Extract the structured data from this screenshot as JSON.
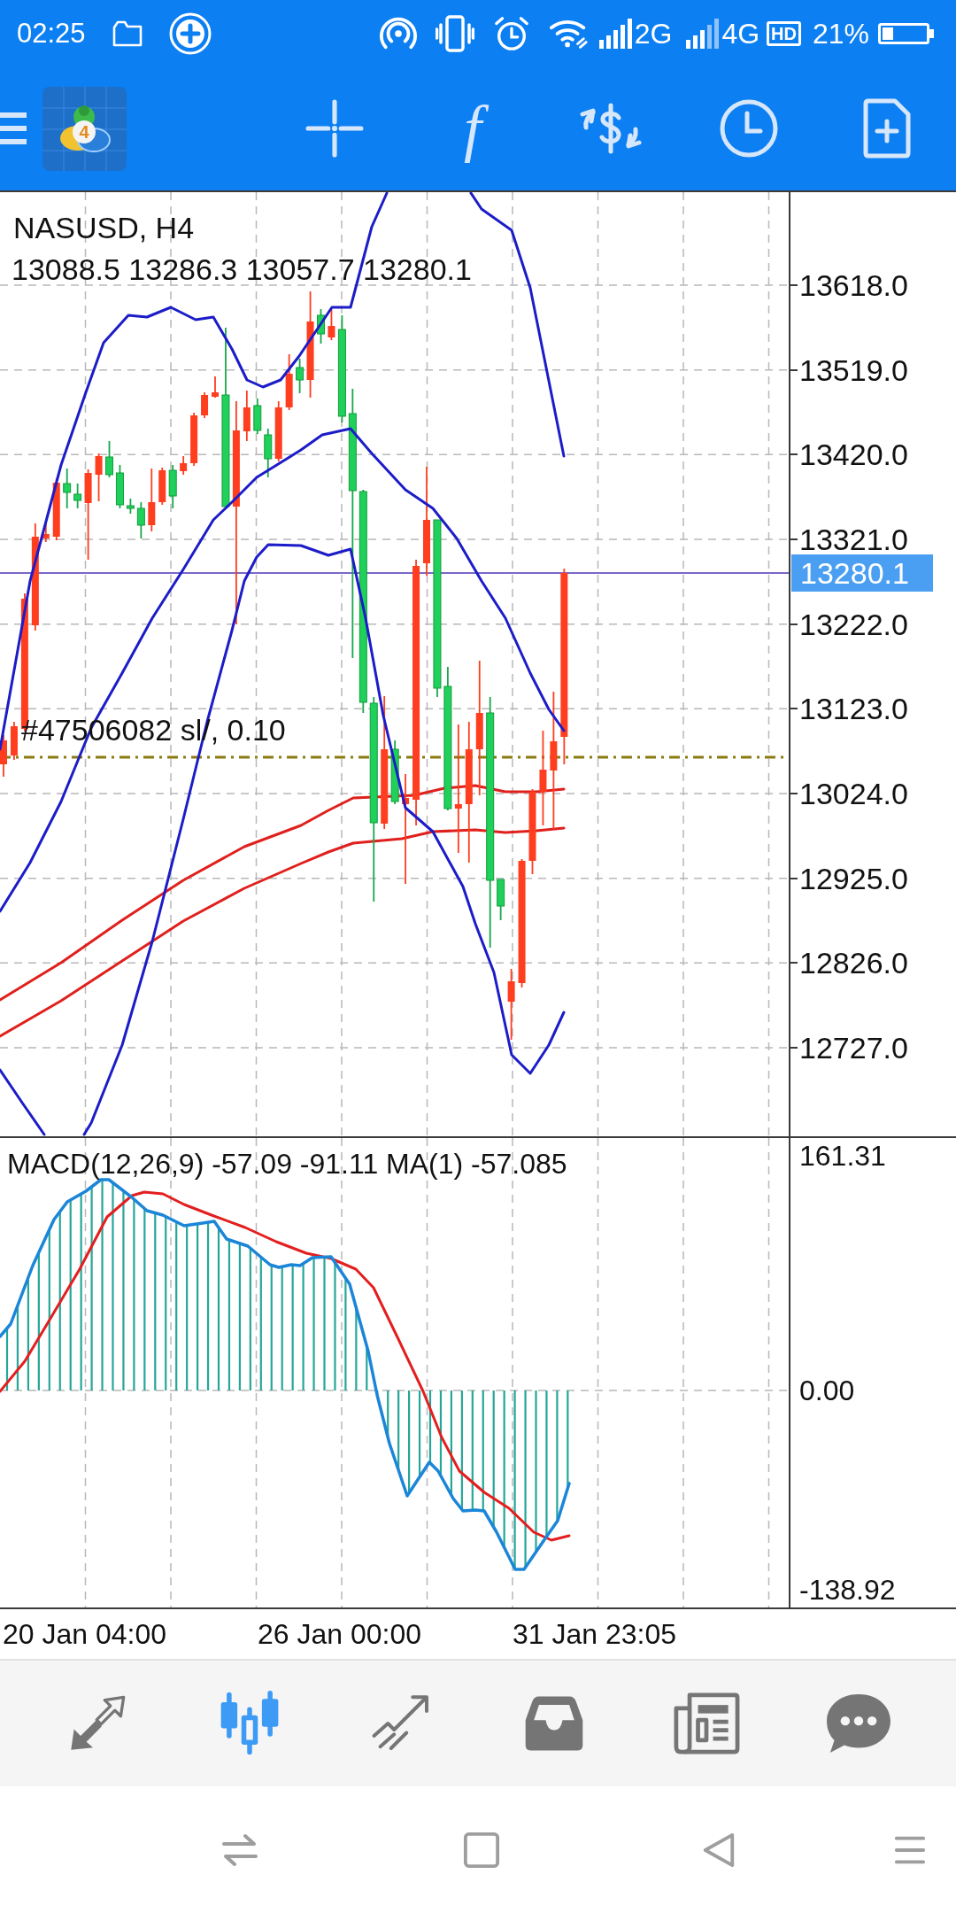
{
  "status_bar": {
    "time": "02:25",
    "network_1": "2G",
    "network_2": "4G",
    "hd_badge": "HD",
    "battery": "21%"
  },
  "toolbar": {
    "logo_badge": "4",
    "buttons": [
      {
        "kind": "crosshair"
      },
      {
        "kind": "function",
        "label": "f"
      },
      {
        "kind": "trade"
      },
      {
        "kind": "period"
      },
      {
        "kind": "new"
      }
    ]
  },
  "chart": {
    "symbol": "NASUSD, H4",
    "ohlc": "13088.5 13286.3 13057.7 13280.1",
    "order_label": "#47506082 sl/, 0.10",
    "price_ticks": [
      "13618.0",
      "13519.0",
      "13420.0",
      "13321.0",
      "13222.0",
      "13123.0",
      "13024.0",
      "12925.0",
      "12826.0",
      "12727.0"
    ],
    "current_price": "13280.1"
  },
  "macd": {
    "label": "MACD(12,26,9) -57.09 -91.11 MA(1) -57.085",
    "ticks": [
      "161.31",
      "0.00",
      "-138.92"
    ]
  },
  "time_axis": [
    "20 Jan 04:00",
    "26 Jan 00:00",
    "31 Jan 23:05"
  ],
  "bottom_nav": [
    {
      "kind": "quotes",
      "selected": false
    },
    {
      "kind": "chart",
      "selected": true
    },
    {
      "kind": "trade",
      "selected": false
    },
    {
      "kind": "history",
      "selected": false
    },
    {
      "kind": "news",
      "selected": false
    },
    {
      "kind": "chat",
      "selected": false
    }
  ],
  "system_nav": [
    {
      "kind": "swap"
    },
    {
      "kind": "recents"
    },
    {
      "kind": "back"
    },
    {
      "kind": "menu"
    }
  ]
}
